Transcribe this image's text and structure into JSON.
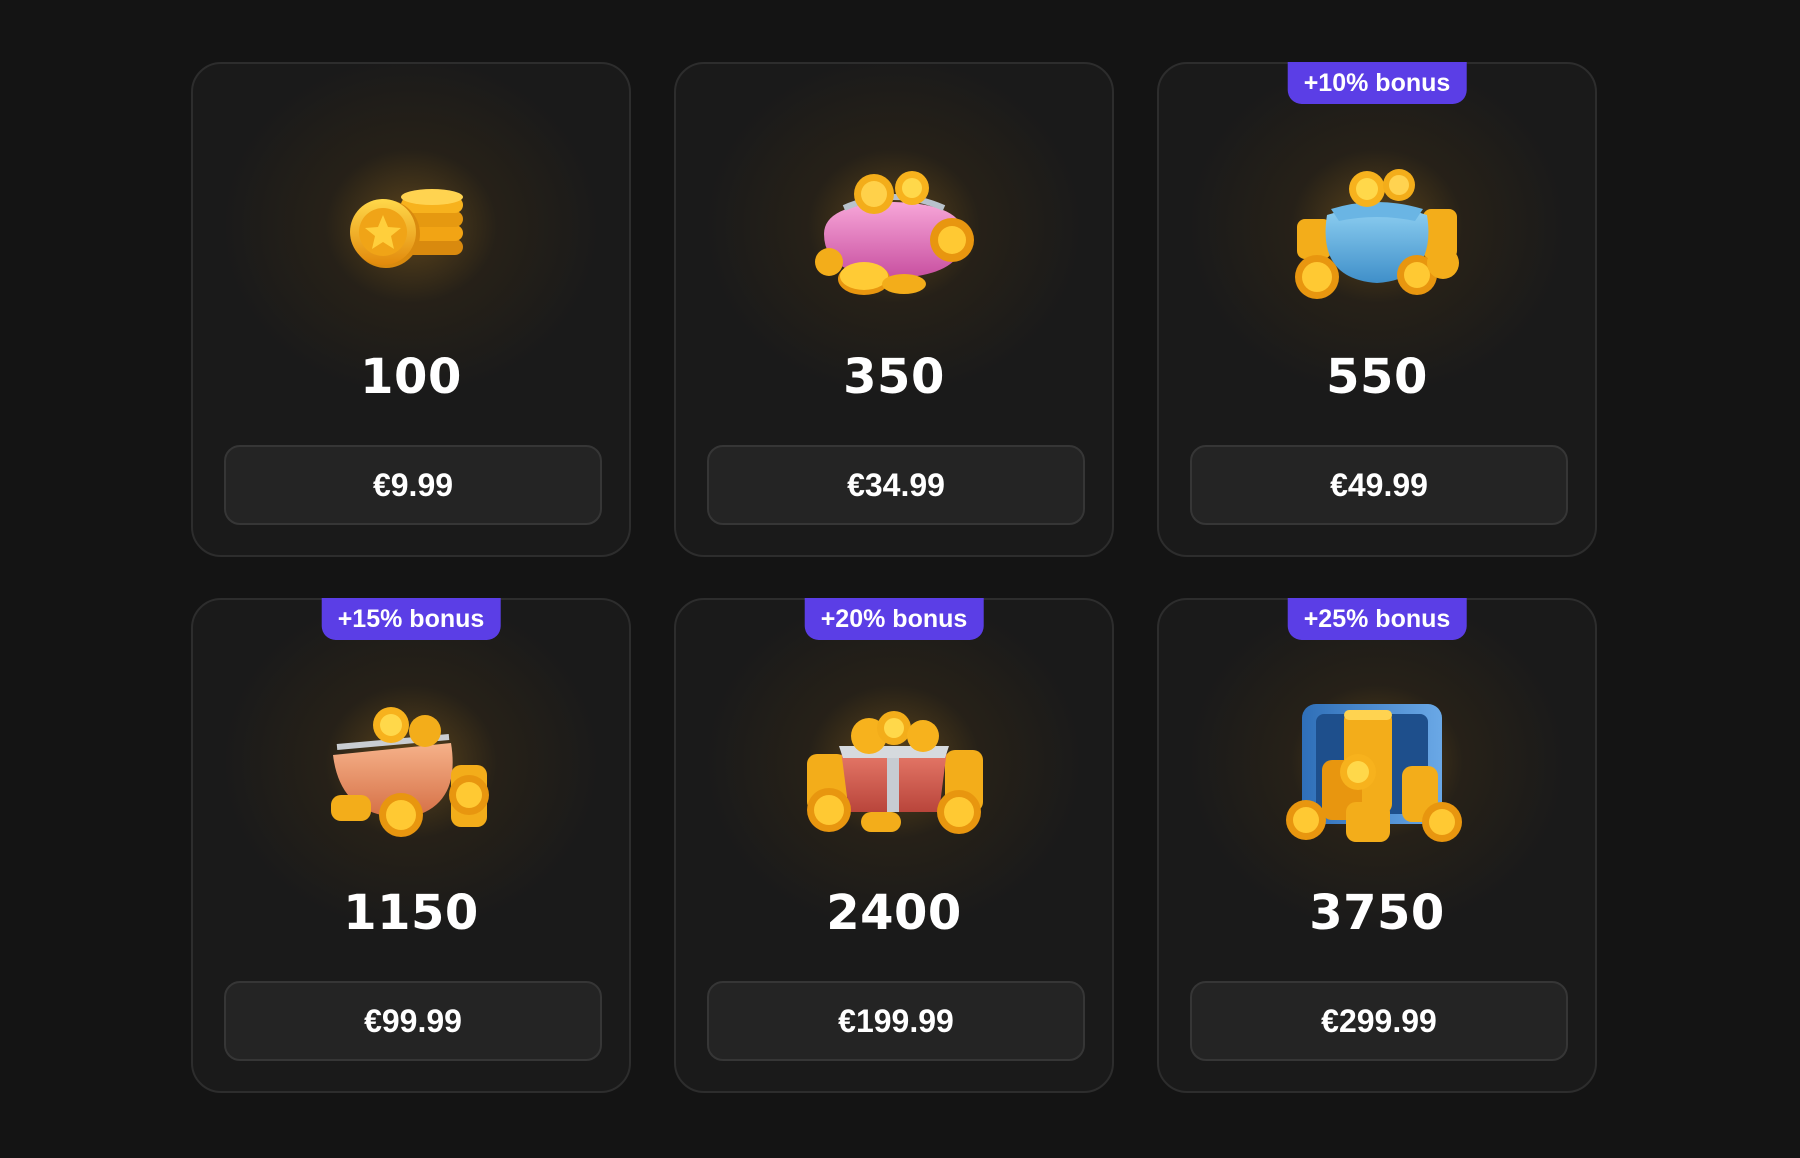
{
  "packs": [
    {
      "amount": "100",
      "price": "€9.99",
      "bonus": "",
      "art": "coin-stack"
    },
    {
      "amount": "350",
      "price": "€34.99",
      "bonus": "",
      "art": "coin-purse"
    },
    {
      "amount": "550",
      "price": "€49.99",
      "bonus": "+10% bonus",
      "art": "coin-bag"
    },
    {
      "amount": "1150",
      "price": "€99.99",
      "bonus": "+15% bonus",
      "art": "coin-pouch"
    },
    {
      "amount": "2400",
      "price": "€199.99",
      "bonus": "+20% bonus",
      "art": "coin-chest"
    },
    {
      "amount": "3750",
      "price": "€299.99",
      "bonus": "+25% bonus",
      "art": "coin-vault"
    }
  ],
  "colors": {
    "background": "#141414",
    "card": "#1a1a1a",
    "badge": "#5b3ee6",
    "gold": "#f6b41c"
  }
}
